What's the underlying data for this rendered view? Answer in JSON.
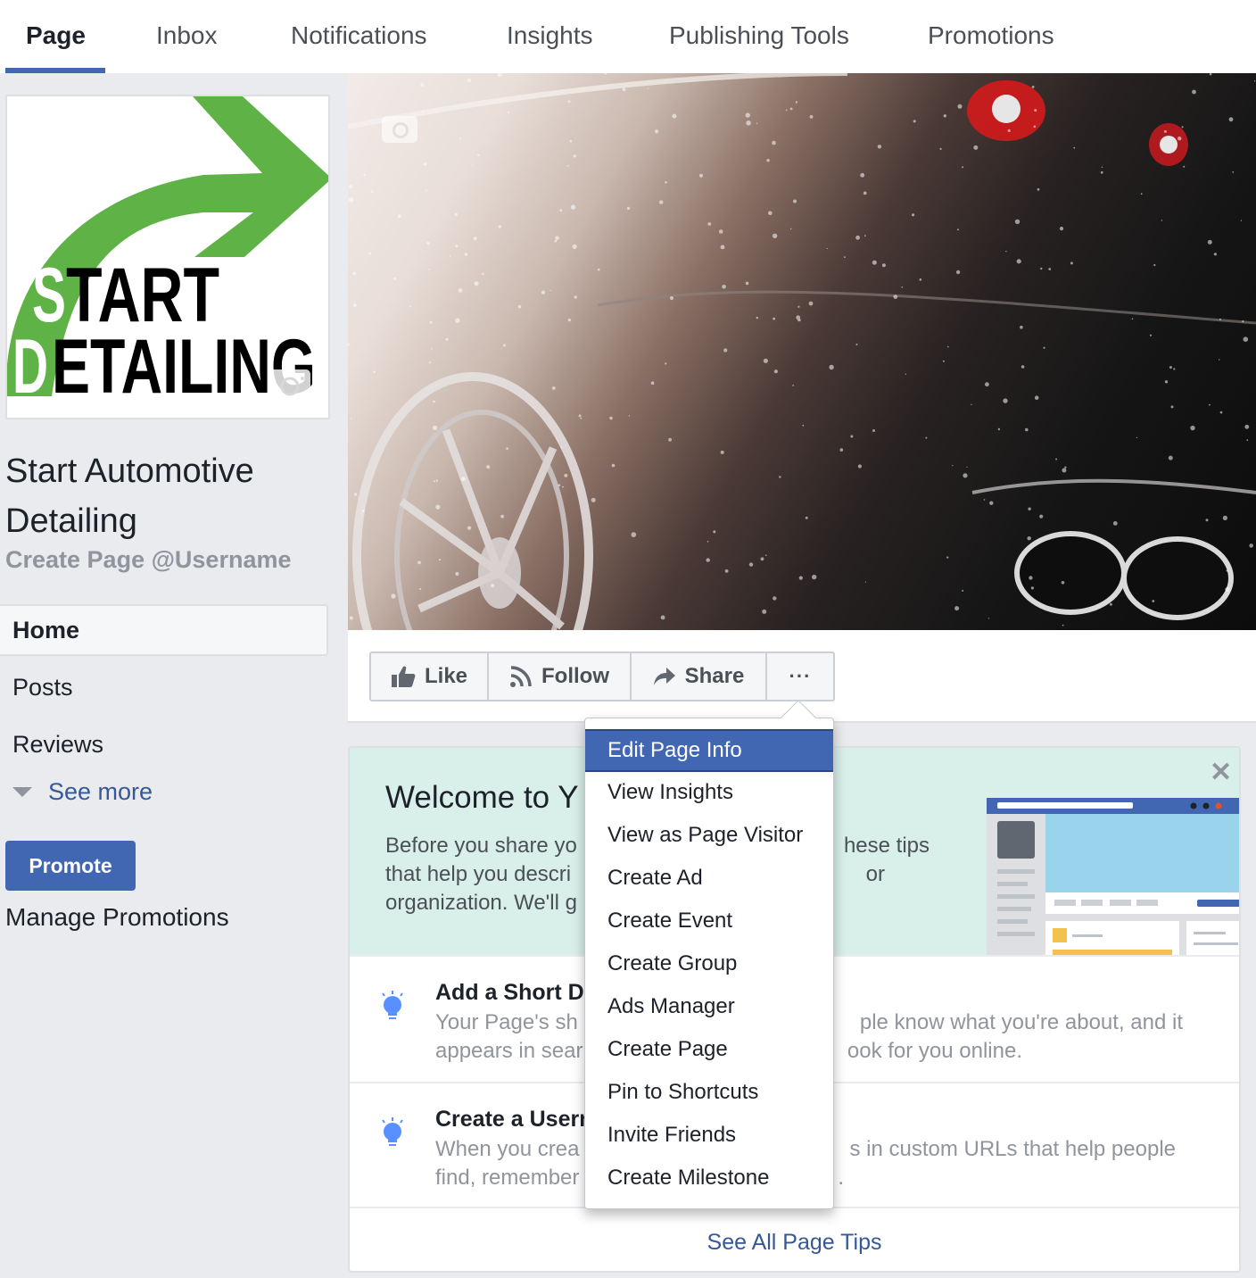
{
  "tabs": [
    {
      "label": "Page",
      "active": true
    },
    {
      "label": "Inbox",
      "active": false
    },
    {
      "label": "Notifications",
      "active": false
    },
    {
      "label": "Insights",
      "active": false
    },
    {
      "label": "Publishing Tools",
      "active": false
    },
    {
      "label": "Promotions",
      "active": false
    }
  ],
  "profile": {
    "logo_line1_first": "S",
    "logo_line1_rest": "TART",
    "logo_line2_first": "D",
    "logo_line2_rest": "ETAILING",
    "brand_green": "#5fb346",
    "name": "Start Automotive Detailing",
    "username_link": "Create Page @Username"
  },
  "sidebar": {
    "items": [
      {
        "label": "Home",
        "active": true
      },
      {
        "label": "Posts",
        "active": false
      },
      {
        "label": "Reviews",
        "active": false
      }
    ],
    "see_more": "See more",
    "promote_button": "Promote",
    "manage_promotions": "Manage Promotions"
  },
  "actions": {
    "like": "Like",
    "follow": "Follow",
    "share": "Share",
    "more": "···"
  },
  "welcome": {
    "title": "Welcome to Y",
    "text": "Before you share yo                                   hese tips that help you descri                                   or organization. We'll g",
    "close": "✕",
    "tips": [
      {
        "title": "Add a Short De",
        "text": "Your Page's sh                                     ple know what you're about, and it appears in sear                                    ook for you online."
      },
      {
        "title": "Create a Usern",
        "text": "When you crea                                     s in custom URLs that help people find, remember                                   ."
      }
    ],
    "see_all": "See All Page Tips"
  },
  "dropdown": {
    "items": [
      {
        "label": "Edit Page Info",
        "highlighted": true
      },
      {
        "label": "View Insights",
        "highlighted": false
      },
      {
        "label": "View as Page Visitor",
        "highlighted": false
      },
      {
        "label": "Create Ad",
        "highlighted": false
      },
      {
        "label": "Create Event",
        "highlighted": false
      },
      {
        "label": "Create Group",
        "highlighted": false
      },
      {
        "label": "Ads Manager",
        "highlighted": false
      },
      {
        "label": "Create Page",
        "highlighted": false
      },
      {
        "label": "Pin to Shortcuts",
        "highlighted": false
      },
      {
        "label": "Invite Friends",
        "highlighted": false
      },
      {
        "label": "Create Milestone",
        "highlighted": false
      }
    ]
  },
  "colors": {
    "accent": "#4267b2",
    "link": "#365899",
    "welcome_bg": "#d9efe9",
    "tip_icon": "#5890ff"
  }
}
